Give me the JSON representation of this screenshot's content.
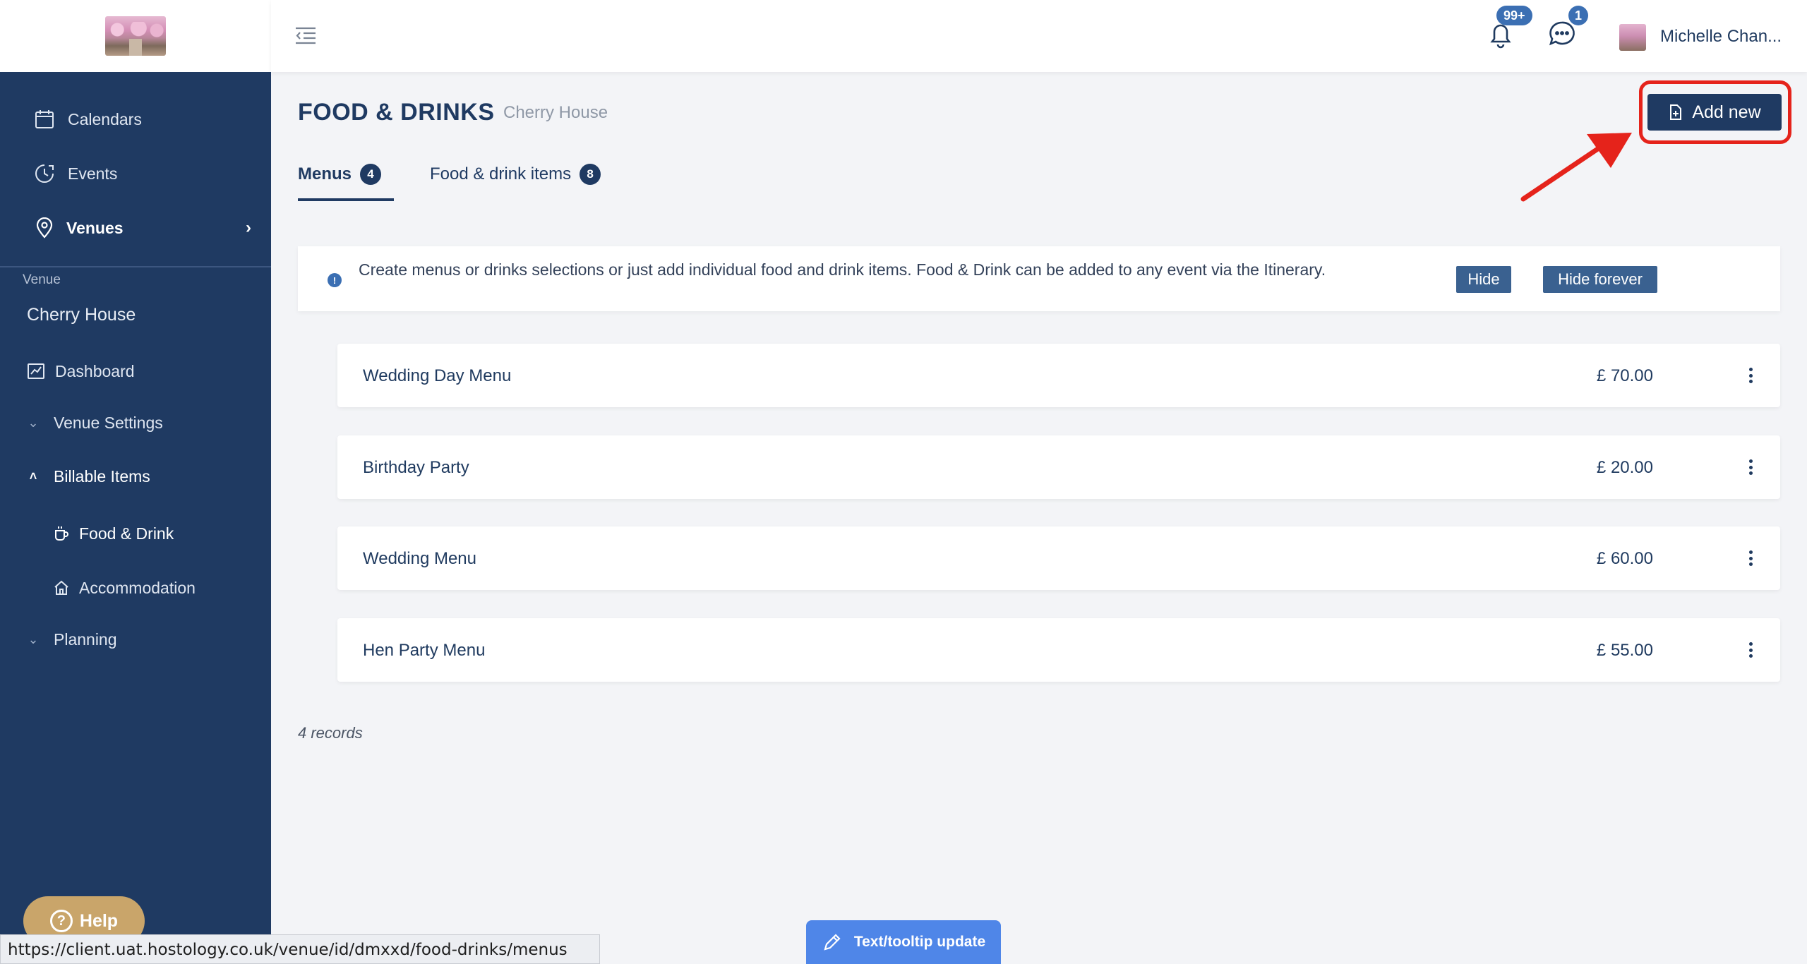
{
  "sidebar": {
    "nav": [
      {
        "label": "Calendars",
        "icon": "calendar-icon"
      },
      {
        "label": "Events",
        "icon": "clock-icon"
      },
      {
        "label": "Venues",
        "icon": "location-pin-icon"
      }
    ],
    "venue_label": "Venue",
    "venue_name": "Cherry House",
    "venue_nav": [
      {
        "label": "Dashboard",
        "icon": "chart-icon"
      },
      {
        "label": "Venue Settings",
        "icon": "chevron-down-icon"
      },
      {
        "label": "Billable Items",
        "icon": "chevron-up-icon"
      },
      {
        "label": "Food & Drink",
        "icon": "cup-icon"
      },
      {
        "label": "Accommodation",
        "icon": "home-icon"
      },
      {
        "label": "Planning",
        "icon": "chevron-down-icon"
      }
    ],
    "help_label": "Help"
  },
  "topbar": {
    "notifications_badge": "99+",
    "messages_badge": "1",
    "user_name": "Michelle Chan..."
  },
  "page": {
    "title": "FOOD & DRINKS",
    "subtitle": "Cherry House",
    "add_button_label": "Add new"
  },
  "tabs": [
    {
      "label": "Menus",
      "count": "4",
      "active": true
    },
    {
      "label": "Food & drink items",
      "count": "8",
      "active": false
    }
  ],
  "info": {
    "text": "Create menus or drinks selections or just add individual food and drink items. Food & Drink can be added to any event via the Itinerary.",
    "hide_label": "Hide",
    "hide_forever_label": "Hide forever"
  },
  "menus": [
    {
      "name": "Wedding Day Menu",
      "price": "£ 70.00"
    },
    {
      "name": "Birthday Party",
      "price": "£ 20.00"
    },
    {
      "name": "Wedding Menu",
      "price": "£ 60.00"
    },
    {
      "name": "Hen Party Menu",
      "price": "£ 55.00"
    }
  ],
  "records_text": "4 records",
  "status_url": "https://client.uat.hostology.co.uk/venue/id/dmxxd/food-drinks/menus",
  "tooltip_update_label": "Text/tooltip update",
  "colors": {
    "sidebar_bg": "#1f3a62",
    "primary": "#1f3a62",
    "highlight_red": "#e5231b",
    "badge_blue": "#3b6fb3",
    "help_gold": "#c9a56a",
    "tooltip_blue": "#4f86e8"
  }
}
